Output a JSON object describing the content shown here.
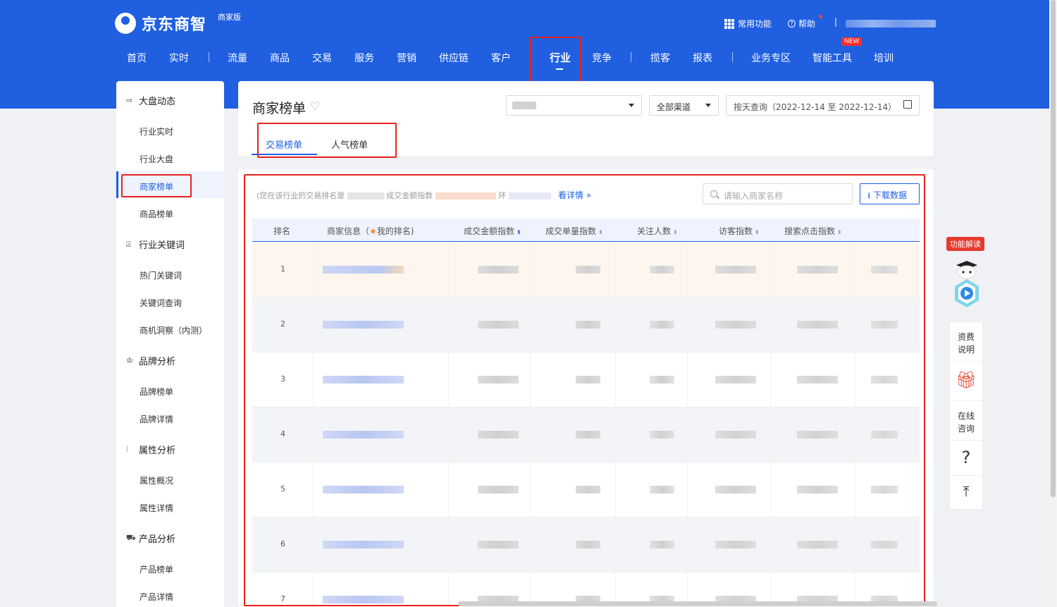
{
  "brand": {
    "logo_text": "京东商智",
    "edition": "商家版"
  },
  "top_right": {
    "common_functions": "常用功能",
    "help": "帮助",
    "divider": "|"
  },
  "nav": {
    "items": [
      "首页",
      "实时",
      "流量",
      "商品",
      "交易",
      "服务",
      "营销",
      "供应链",
      "客户",
      "行业",
      "竞争",
      "揽客",
      "报表",
      "业务专区",
      "智能工具",
      "培训"
    ],
    "active": "行业",
    "new_badge": "NEW"
  },
  "sidebar": {
    "groups": [
      {
        "title": "大盘动态",
        "icon": "arrow-icon",
        "items": [
          "行业实时",
          "行业大盘",
          "商家榜单",
          "商品榜单"
        ]
      },
      {
        "title": "行业关键词",
        "icon": "keyword-icon",
        "items": [
          "热门关键词",
          "关键词查询",
          "商机洞察（内测）"
        ]
      },
      {
        "title": "品牌分析",
        "icon": "crown-icon",
        "items": [
          "品牌榜单",
          "品牌详情"
        ]
      },
      {
        "title": "属性分析",
        "icon": "sliders-icon",
        "items": [
          "属性概况",
          "属性详情"
        ]
      },
      {
        "title": "产品分析",
        "icon": "cart-icon",
        "items": [
          "产品榜单",
          "产品详情"
        ]
      }
    ],
    "active_item": "商家榜单"
  },
  "header": {
    "title": "商家榜单",
    "channel_select": "全部渠道",
    "date_select": "按天查询（2022-12-14 至 2022-12-14）",
    "tabs": [
      "交易榜单",
      "人气榜单"
    ],
    "active_tab": "交易榜单"
  },
  "main": {
    "info_prefix": "(您在该行业的交易排名是",
    "info_mid1": "成交金额指数",
    "info_mid2": "环",
    "detail_link": "看详情 »",
    "search_placeholder": "请输入商家名称",
    "download_label": "下载数据",
    "columns": {
      "rank": "排名",
      "merchant_prefix": "商家信息（",
      "merchant_suffix": "我的排名)",
      "gmv_index": "成交金额指数",
      "volume_index": "成交单量指数",
      "followers": "关注人数",
      "visitor_index": "访客指数",
      "search_click_index": "搜索点击指数"
    },
    "rows": [
      {
        "rank": "1"
      },
      {
        "rank": "2"
      },
      {
        "rank": "3"
      },
      {
        "rank": "4"
      },
      {
        "rank": "5"
      },
      {
        "rank": "6"
      },
      {
        "rank": "7"
      }
    ]
  },
  "side_tools": {
    "func_badge": "功能解读",
    "items": [
      "资费\n说明",
      "在线\n咨询",
      "?"
    ]
  },
  "colors": {
    "brand_blue": "#1f5fe0",
    "annotation_red": "#e6231f",
    "badge_red": "#ff2b2b"
  }
}
